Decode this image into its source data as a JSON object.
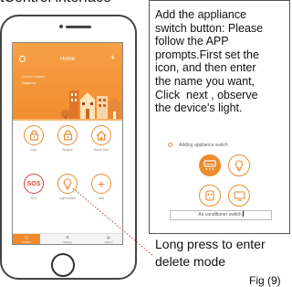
{
  "heading": "tControl interface",
  "phone": {
    "home": {
      "title": "Home",
      "location": "Current Location",
      "place": "Shapemi"
    },
    "tiles": [
      {
        "label": "lock",
        "icon": "padlock-icon"
      },
      {
        "label": "Shapes",
        "icon": "padlock-icon"
      },
      {
        "label": "Home Ree",
        "icon": "house-icon"
      },
      {
        "label": "SOS",
        "symbol": "SOS",
        "icon": "sos-icon"
      },
      {
        "label": "Light switch",
        "icon": "lightbulb-icon"
      },
      {
        "label": "Add",
        "symbol": "+",
        "icon": "plus-icon"
      }
    ],
    "tabs": [
      {
        "label": "Control",
        "icon": "control-icon"
      },
      {
        "label": "Setting",
        "icon": "setting-icon"
      },
      {
        "label": "History",
        "icon": "history-icon"
      }
    ],
    "accent": "#ee8a2e"
  },
  "panel": {
    "instructions": "Add the appliance\nswitch button: Please\nfollow the APP\nprompts.First set the\nicon, and then enter\nthe name you want,\nClick  next , observe\nthe device's light.",
    "adding_label": "Adding appliance switch",
    "appliance_icons": [
      "air-conditioner-icon",
      "lightbulb-icon",
      "socket-icon",
      "television-icon"
    ],
    "name_value": "Air conditioner switch"
  },
  "note": "Long press to enter\ndelete mode",
  "figure_label": "Fig (9)"
}
